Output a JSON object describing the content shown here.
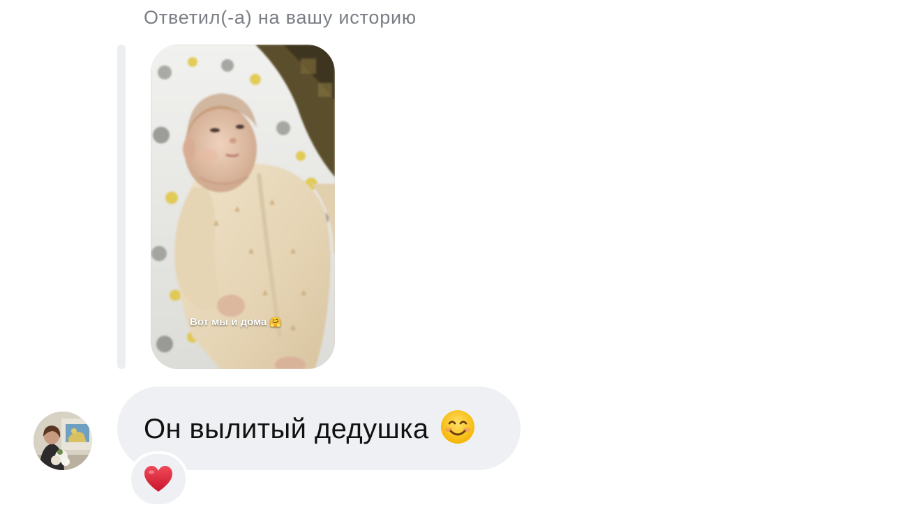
{
  "reply": {
    "caption": "Ответил(-а) на вашу историю"
  },
  "story": {
    "overlay_text": "Вот мы и дома",
    "overlay_emoji": "🤗",
    "image_icon": "story-photo"
  },
  "message": {
    "text": "Он вылитый дедушка",
    "emoji_icon": "smiling-face-icon",
    "bubble_color": "#eef0f3",
    "text_color": "#111111"
  },
  "reaction": {
    "icon": "heart-icon",
    "color": "#e0263a"
  },
  "sender": {
    "avatar_icon": "avatar"
  },
  "colors": {
    "caption": "#7a7e84",
    "quote_line": "#eceef1",
    "background": "#ffffff"
  }
}
